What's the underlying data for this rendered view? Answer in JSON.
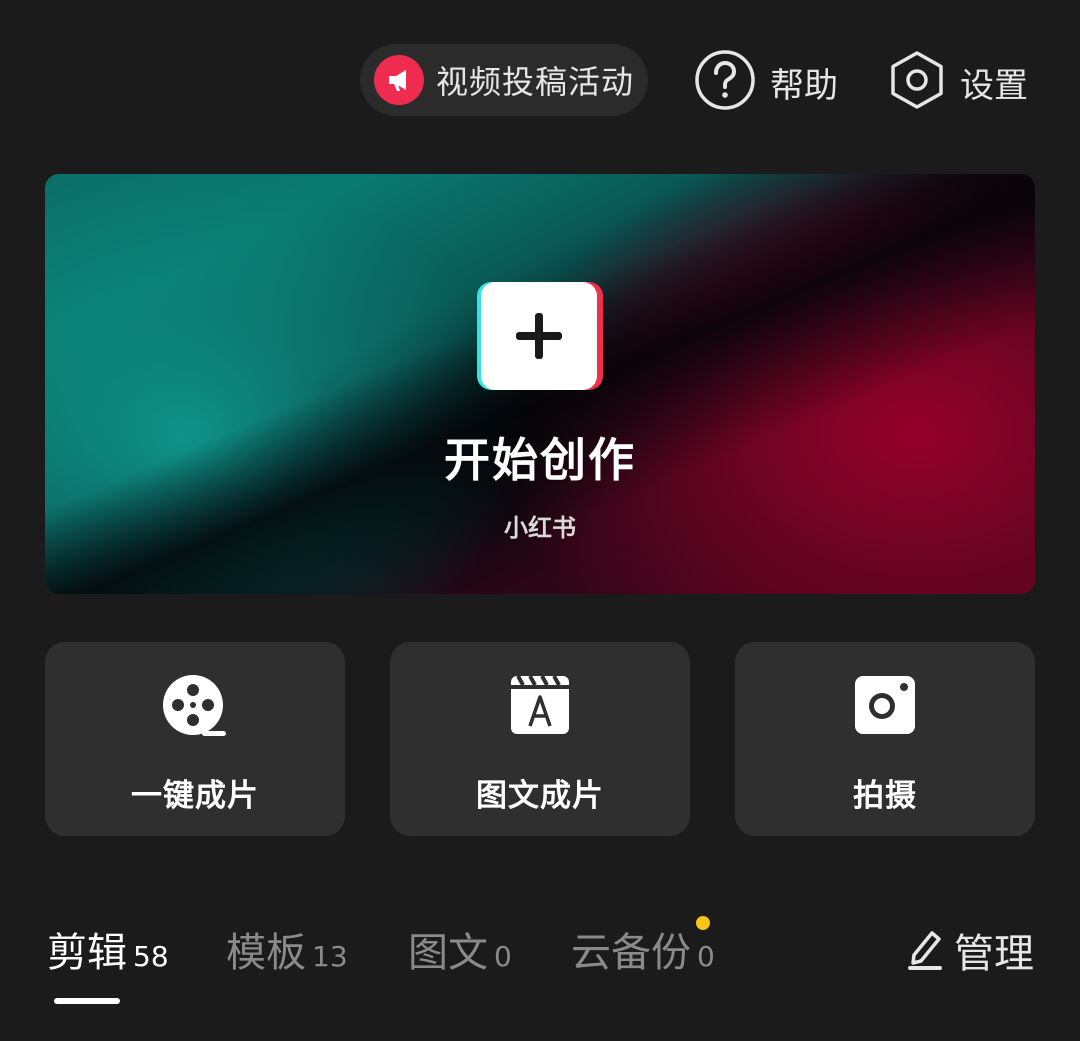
{
  "topbar": {
    "campaign": {
      "label": "视频投稿活动",
      "icon": "megaphone-icon",
      "icon_color": "#ee2c50"
    },
    "help": {
      "label": "帮助",
      "icon": "question-circle-icon"
    },
    "settings": {
      "label": "设置",
      "icon": "hexagon-gear-icon"
    }
  },
  "hero": {
    "title": "开始创作",
    "subtitle": "小红书",
    "icon": "plus-icon",
    "colors": {
      "teal": "#0a7a70",
      "crimson": "#95002c",
      "cyan_edge": "#34e2e4",
      "red_edge": "#f02f4b"
    }
  },
  "quick_actions": [
    {
      "label": "一键成片",
      "icon": "film-reel-icon"
    },
    {
      "label": "图文成片",
      "icon": "clapper-text-icon"
    },
    {
      "label": "拍摄",
      "icon": "camera-icon"
    }
  ],
  "tabs": [
    {
      "label": "剪辑",
      "count": "58",
      "active": true
    },
    {
      "label": "模板",
      "count": "13",
      "active": false
    },
    {
      "label": "图文",
      "count": "0",
      "active": false
    },
    {
      "label": "云备份",
      "count": "0",
      "active": false,
      "badge_color": "#f5c518"
    }
  ],
  "manage": {
    "label": "管理",
    "icon": "edit-pen-icon"
  }
}
